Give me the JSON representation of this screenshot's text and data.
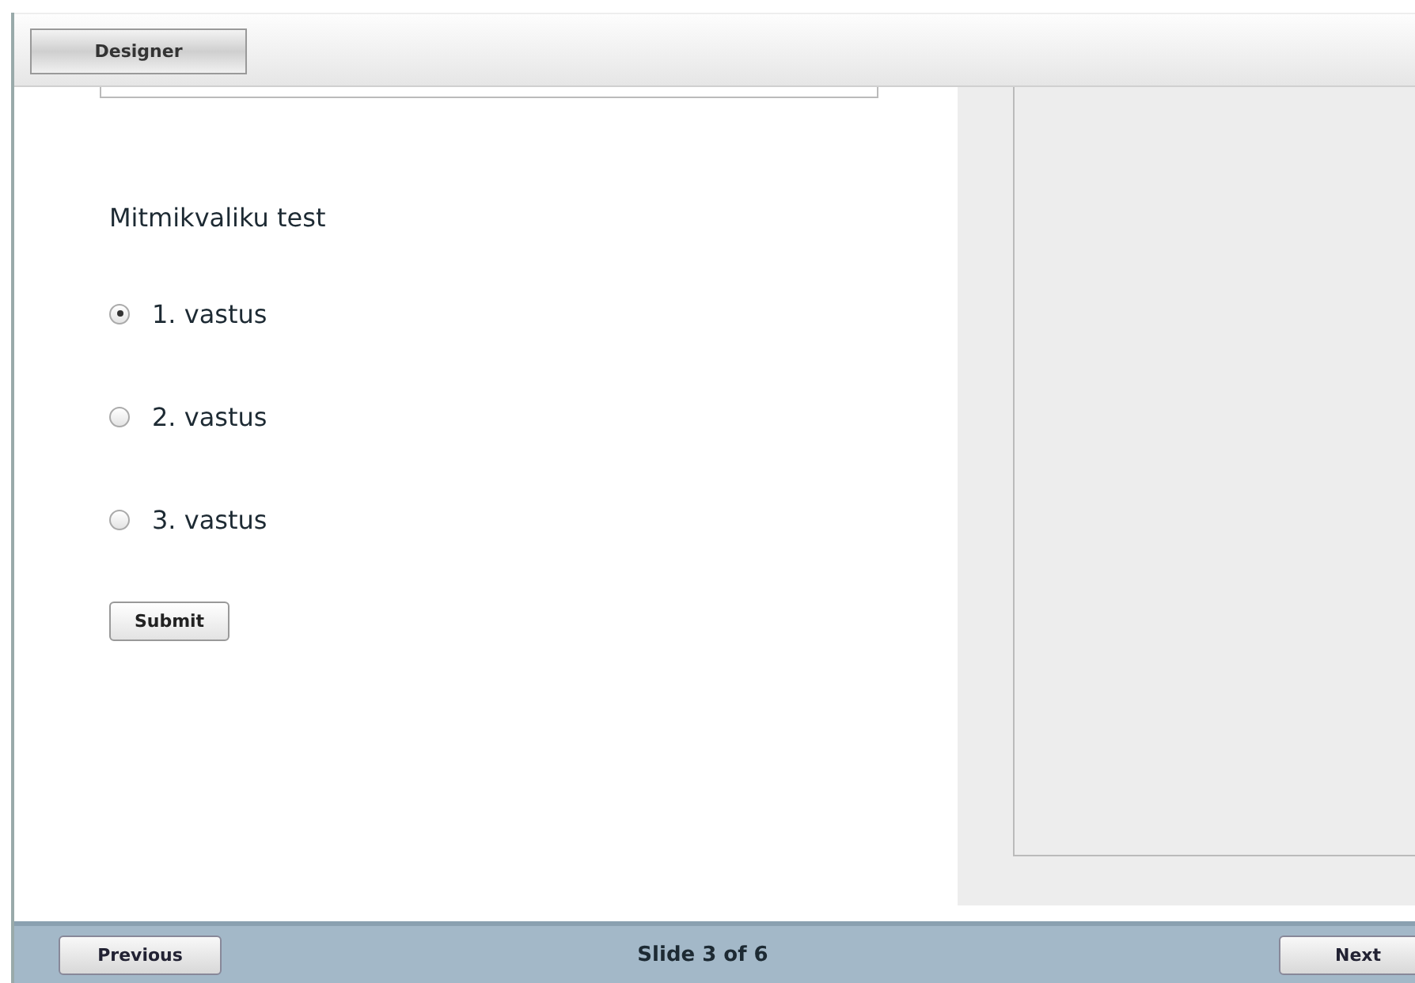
{
  "toolbar": {
    "button": "Designer"
  },
  "question": {
    "title": "Mitmikvaliku test",
    "options": [
      {
        "label": "1. vastus",
        "selected": true
      },
      {
        "label": "2. vastus",
        "selected": false
      },
      {
        "label": "3. vastus",
        "selected": false
      }
    ],
    "submit": "Submit"
  },
  "footer": {
    "previous": "Previous",
    "status": "Slide 3 of 6",
    "next": "Next"
  }
}
